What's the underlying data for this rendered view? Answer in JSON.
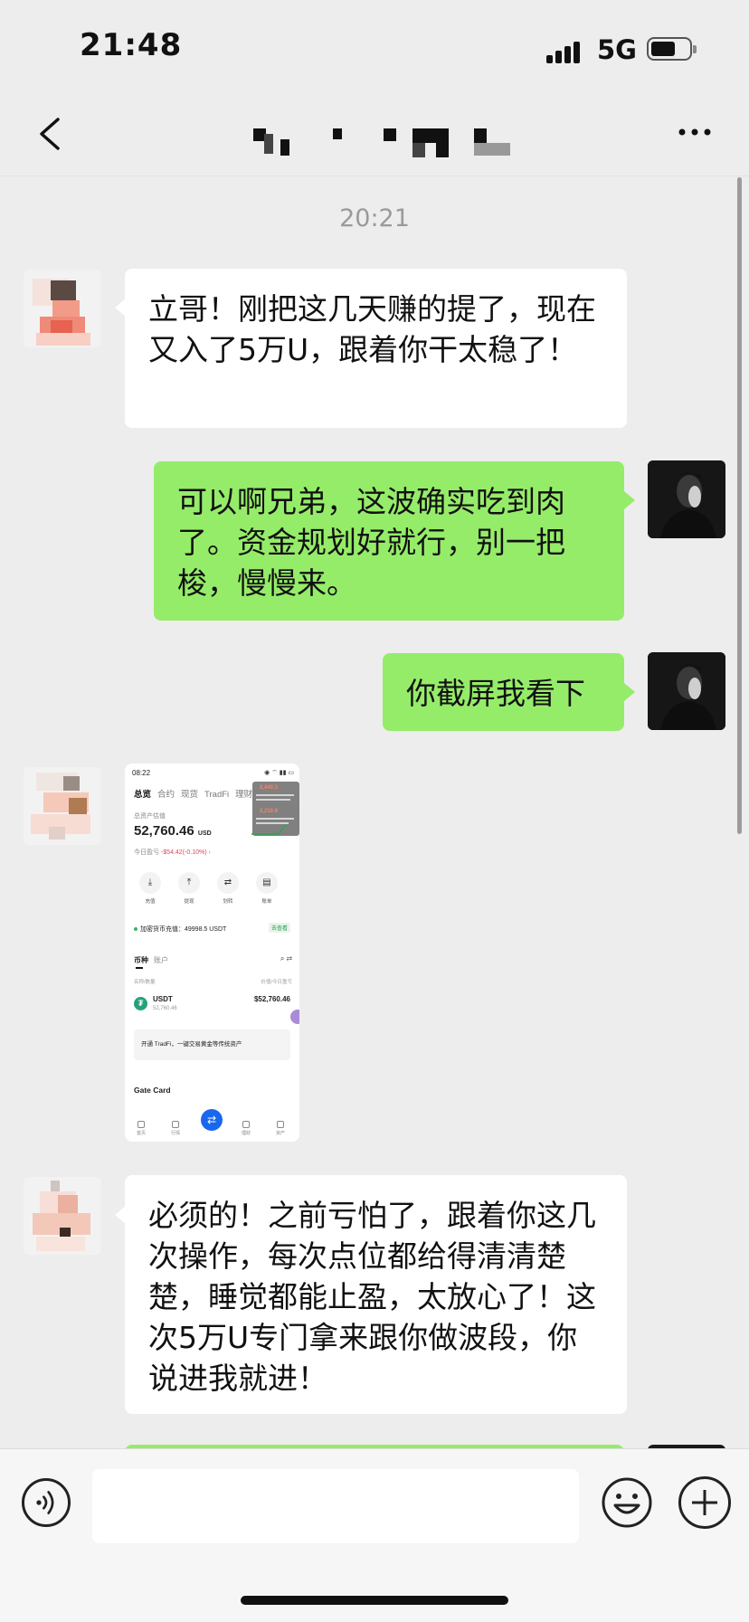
{
  "status_bar": {
    "time": "21:48",
    "network": "5G",
    "battery_icon": "battery-icon",
    "signal_icon": "cellular-signal-icon"
  },
  "nav": {
    "back_icon": "chevron-left-icon",
    "more_icon": "more-dots-icon",
    "title_obscured": true
  },
  "chat": {
    "timestamp": "20:21",
    "messages": [
      {
        "id": "m1",
        "side": "in",
        "type": "text",
        "text": "立哥！刚把这几天赚的提了，现在又入了5万U，跟着你干太稳了！"
      },
      {
        "id": "m2",
        "side": "out",
        "type": "text",
        "text": "可以啊兄弟，这波确实吃到肉了。资金规划好就行，别一把梭，慢慢来。"
      },
      {
        "id": "m3",
        "side": "out",
        "type": "text",
        "text": "你截屏我看下"
      },
      {
        "id": "m4",
        "side": "in",
        "type": "image"
      },
      {
        "id": "m5",
        "side": "in",
        "type": "text",
        "text": "必须的！之前亏怕了，跟着你这几次操作，每次点位都给得清清楚楚，睡觉都能止盈，太放心了！这次5万U专门拿来跟你做波段，你说进我就进！"
      }
    ]
  },
  "screenshot": {
    "time": "08:22",
    "tabs": [
      {
        "label": "总览",
        "active": true
      },
      {
        "label": "合约"
      },
      {
        "label": "现货"
      },
      {
        "label": "TradFi"
      },
      {
        "label": "理财"
      }
    ],
    "asset_label": "总资产估值",
    "total": "52,760.46",
    "currency": "USD",
    "pnl_label": "今日盈亏",
    "pnl_value": "-$54.42(-0.10%)",
    "actions": [
      "充值",
      "提现",
      "划转",
      "账单"
    ],
    "deposit_text": "加密货币充值：49998.5 USDT",
    "deposit_link": "去查看",
    "list_tabs": [
      "币种",
      "账户"
    ],
    "col_left": "名称/数量",
    "col_right": "价值/今日盈亏",
    "coin": {
      "symbol": "USDT",
      "amount": "52,760.46",
      "value": "$52,760.46"
    },
    "banner": "开通 TradFi，一键交易黄金等传统资产",
    "gate_card": "Gate Card",
    "bottom_nav": [
      "首页",
      "行情",
      "交易",
      "理财",
      "资产"
    ],
    "toast_amount": "2,440.3",
    "toast_amount_2": "2,210.9"
  },
  "input": {
    "value": "",
    "placeholder": "",
    "voice_icon": "voice-icon",
    "emoji_icon": "emoji-icon",
    "plus_icon": "plus-icon"
  }
}
